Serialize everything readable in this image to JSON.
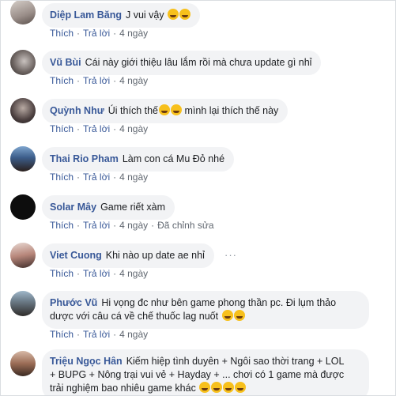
{
  "comments": [
    {
      "author": "Diệp Lam Băng",
      "text": "J vui vậy",
      "emoji_count": 2,
      "actions": [
        "Thích",
        "Trả lời"
      ],
      "time": "4 ngày"
    },
    {
      "author": "Vũ Bùi",
      "text": "Cái này giới thiệu lâu lắm rồi mà chưa update gì nhỉ",
      "actions": [
        "Thích",
        "Trả lời"
      ],
      "time": "4 ngày"
    },
    {
      "author": "Quỳnh Như",
      "text_before": "Úi thích thế",
      "emoji_count": 2,
      "text_after": " mình lại thích thế này",
      "actions": [
        "Thích",
        "Trả lời"
      ],
      "time": "4 ngày"
    },
    {
      "author": "Thai Rio Pham",
      "text": "Làm con cá Mu Đỏ nhé",
      "actions": [
        "Thích",
        "Trả lời"
      ],
      "time": "4 ngày"
    },
    {
      "author": "Solar Mây",
      "text": "Game riết xàm",
      "actions": [
        "Thích",
        "Trả lời"
      ],
      "time": "4 ngày",
      "edited": "Đã chỉnh sửa"
    },
    {
      "author": "Viet Cuong",
      "text": "Khi nào up date ae nhỉ",
      "actions": [
        "Thích",
        "Trả lời"
      ],
      "time": "4 ngày",
      "more": "···"
    },
    {
      "author": "Phước Vũ",
      "line1": "Hi vọng đc như bên game phong thần pc. Đi lụm thảo",
      "line2": "dược với câu cá về chế thuốc lag nuốt",
      "emoji_count": 2,
      "actions": [
        "Thích",
        "Trả lời"
      ],
      "time": "4 ngày"
    },
    {
      "author": "Triệu Ngọc Hân",
      "line1": "Kiếm hiệp tình duyên + Ngôi sao thời trang + LOL",
      "line2": "+ BUPG + Nông trại vui vẻ + Hayday + ... chơi có 1 game mà được",
      "line3": "trải nghiệm bao nhiêu game khác",
      "emoji_count": 4
    }
  ],
  "colors": {
    "author": "#385898",
    "bubble": "#f2f3f5",
    "meta": "#606770"
  }
}
